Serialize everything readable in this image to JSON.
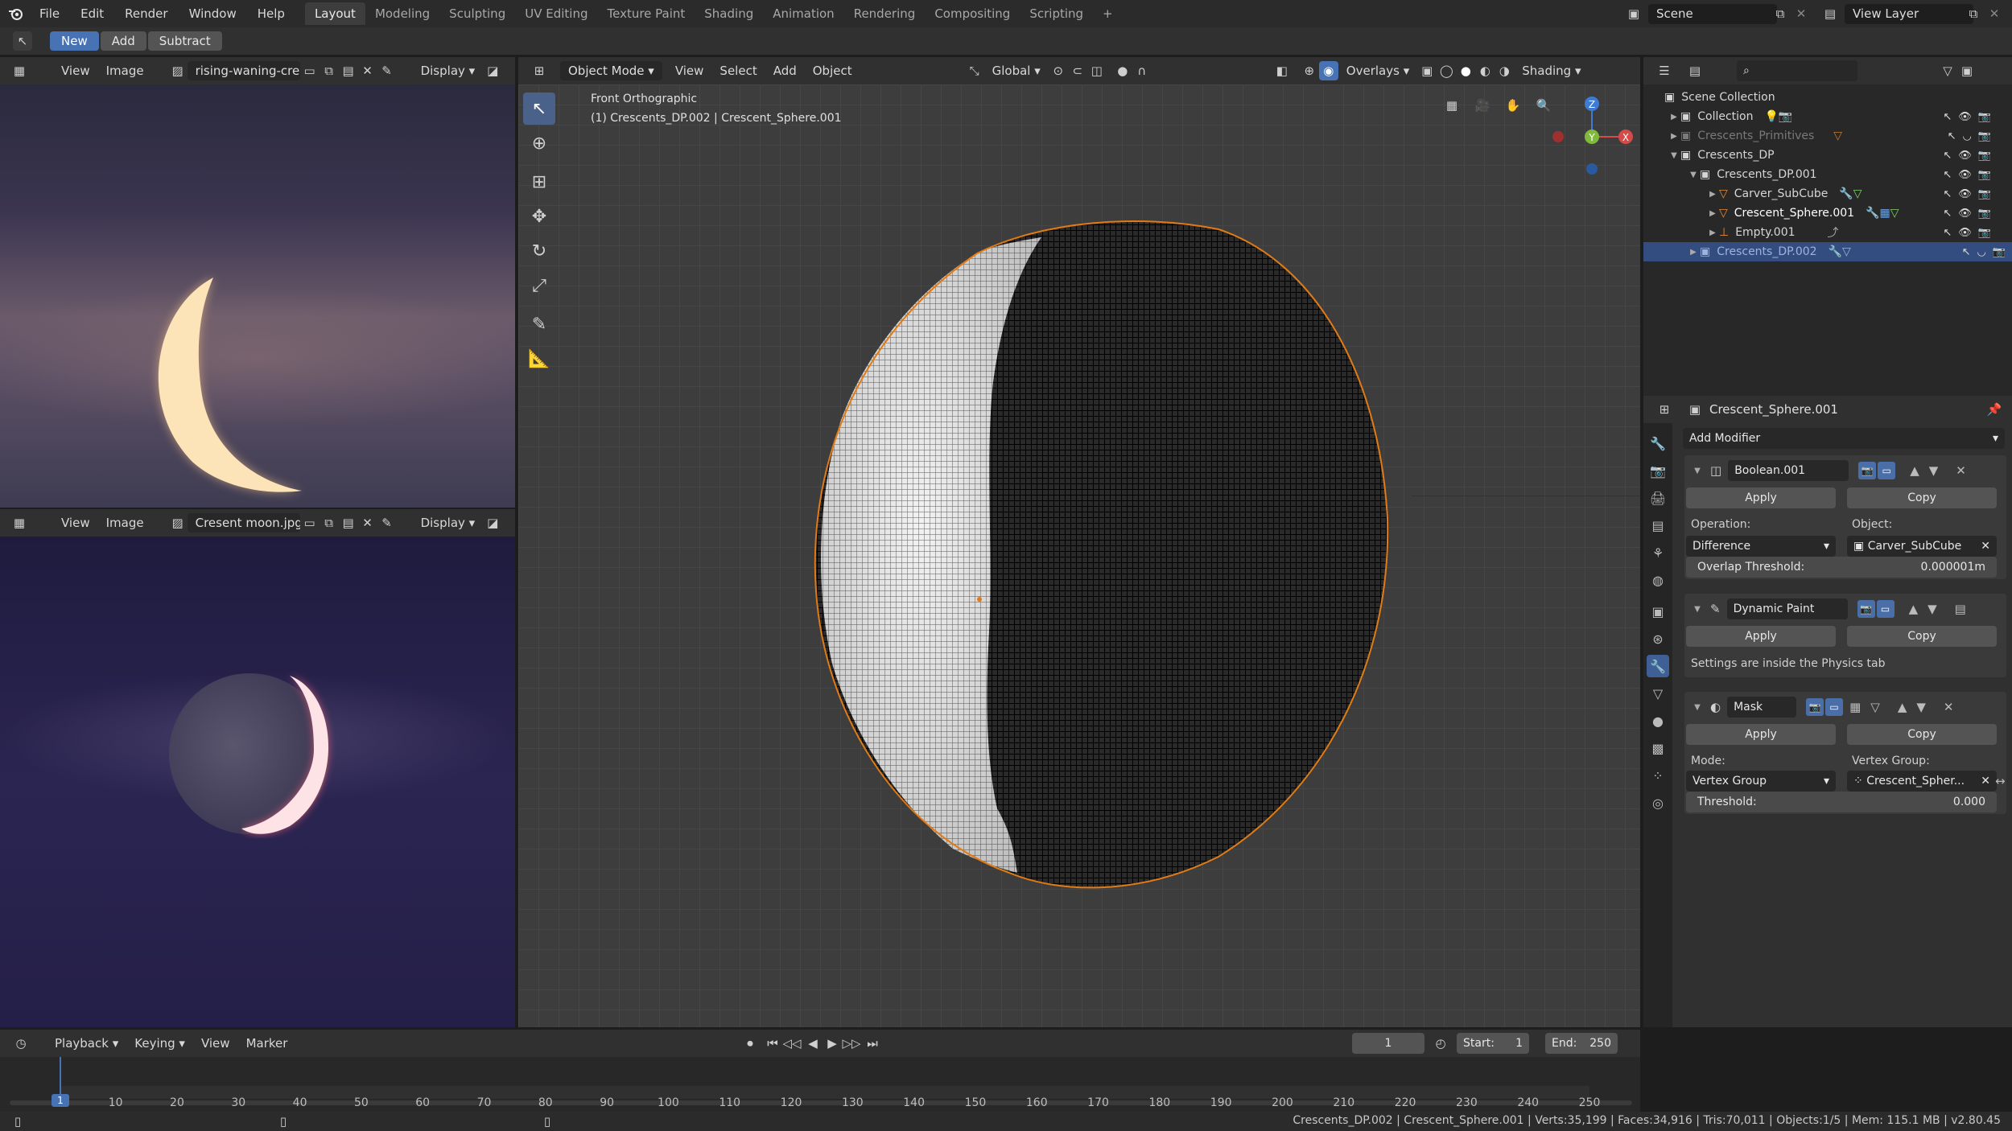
{
  "topbar": {
    "menus": [
      "File",
      "Edit",
      "Render",
      "Window",
      "Help"
    ],
    "workspaces": [
      "Layout",
      "Modeling",
      "Sculpting",
      "UV Editing",
      "Texture Paint",
      "Shading",
      "Animation",
      "Rendering",
      "Compositing",
      "Scripting"
    ],
    "active_workspace": "Layout",
    "add_tab": "+",
    "scene": "Scene",
    "view_layer": "View Layer"
  },
  "toolmode": {
    "new": "New",
    "add": "Add",
    "subtract": "Subtract"
  },
  "image_editor_top": {
    "menu_view": "View",
    "menu_image": "Image",
    "image_name": "rising-waning-cres...",
    "display": "Display"
  },
  "image_editor_bottom": {
    "menu_view": "View",
    "menu_image": "Image",
    "image_name": "Cresent moon.jpg",
    "display": "Display"
  },
  "viewport": {
    "mode": "Object Mode",
    "menus": [
      "View",
      "Select",
      "Add",
      "Object"
    ],
    "orientation": "Global",
    "overlays": "Overlays",
    "shading": "Shading",
    "view_name": "Front Orthographic",
    "object_info": "(1) Crescents_DP.002 | Crescent_Sphere.001",
    "gizmo": {
      "z": "Z",
      "y": "Y",
      "x": "X"
    }
  },
  "outliner": {
    "scene_collection": "Scene Collection",
    "rows": [
      {
        "label": "Collection",
        "indent": 1,
        "expanded": false
      },
      {
        "label": "Crescents_Primitives",
        "indent": 1,
        "expanded": false,
        "dim": true
      },
      {
        "label": "Crescents_DP",
        "indent": 1,
        "expanded": true
      },
      {
        "label": "Crescents_DP.001",
        "indent": 2,
        "expanded": true
      },
      {
        "label": "Carver_SubCube",
        "indent": 3,
        "expanded": false
      },
      {
        "label": "Crescent_Sphere.001",
        "indent": 3,
        "expanded": false
      },
      {
        "label": "Empty.001",
        "indent": 3,
        "expanded": false
      },
      {
        "label": "Crescents_DP.002",
        "indent": 2,
        "expanded": false,
        "selected": true
      }
    ]
  },
  "properties": {
    "object_name": "Crescent_Sphere.001",
    "add_modifier": "Add Modifier",
    "apply": "Apply",
    "copy": "Copy",
    "boolean": {
      "name": "Boolean.001",
      "operation_label": "Operation:",
      "operation": "Difference",
      "object_label": "Object:",
      "object": "Carver_SubCube",
      "overlap_label": "Overlap Threshold:",
      "overlap": "0.000001m"
    },
    "dynamic_paint": {
      "name": "Dynamic Paint",
      "note": "Settings are inside the Physics tab"
    },
    "mask": {
      "name": "Mask",
      "mode_label": "Mode:",
      "mode": "Vertex Group",
      "vgroup_label": "Vertex Group:",
      "vgroup": "Crescent_Spher...",
      "threshold_label": "Threshold:",
      "threshold": "0.000"
    }
  },
  "timeline": {
    "menus": [
      "Playback",
      "Keying",
      "View",
      "Marker"
    ],
    "current_frame": "1",
    "start_label": "Start:",
    "start": "1",
    "end_label": "End:",
    "end": "250",
    "ticks": [
      "1",
      "10",
      "20",
      "30",
      "40",
      "50",
      "60",
      "70",
      "80",
      "90",
      "100",
      "110",
      "120",
      "130",
      "140",
      "150",
      "160",
      "170",
      "180",
      "190",
      "200",
      "210",
      "220",
      "230",
      "240",
      "250"
    ]
  },
  "statusbar": {
    "text": "Crescents_DP.002 | Crescent_Sphere.001 | Verts:35,199 | Faces:34,916 | Tris:70,011 | Objects:1/5 | Mem: 115.1 MB | v2.80.45"
  }
}
